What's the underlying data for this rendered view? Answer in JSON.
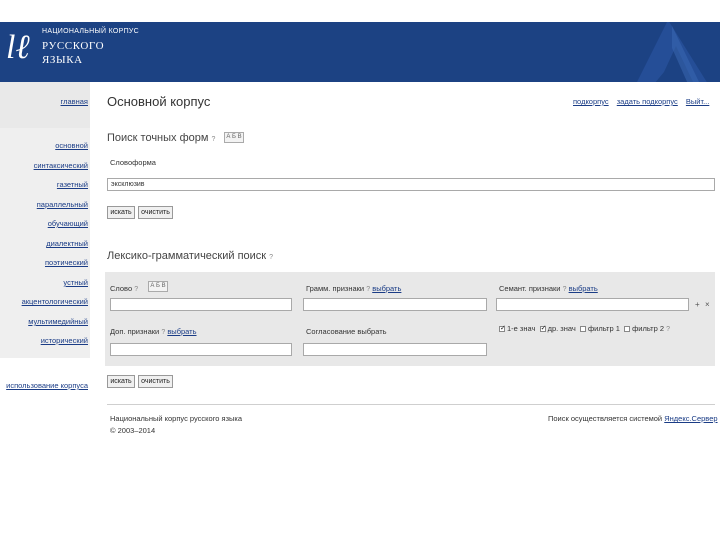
{
  "header": {
    "logo_mark": "lℓ",
    "logo_line1": "НАЦИОНАЛЬНЫЙ КОРПУС",
    "logo_line2": "РУССКОГО",
    "logo_line3": "ЯЗЫКА",
    "bg_color": "#1c4283"
  },
  "sidebar": {
    "home": "главная",
    "items": [
      "основной",
      "синтаксический",
      "газетный",
      "параллельный",
      "обучающий",
      "диалектный",
      "поэтический",
      "устный",
      "акцентологический",
      "мультимедийный",
      "исторический"
    ],
    "usage": "использование корпуса"
  },
  "main": {
    "title": "Основной корпус",
    "top_links": [
      "подкорпус",
      "задать подкорпус",
      "Выйт..."
    ]
  },
  "exact_search": {
    "title": "Поиск точных форм",
    "help": "?",
    "kb1": "А Б В",
    "field_label": "Словоформа",
    "field_value": "эксклюзив",
    "search_btn": "искать",
    "clear_btn": "очистить"
  },
  "lexgram_search": {
    "title": "Лексико-грамматический поиск",
    "help": "?",
    "word_label": "Слово",
    "kb": "А Б В",
    "gram_label": "Грамм. признаки",
    "choose": "выбрать",
    "sem_label": "Семант. признаки",
    "extra_label": "Доп. признаки",
    "choose_extra": "выбрать",
    "agreement_label": "Согласование выбрать",
    "opt1": "1-е знач",
    "opt2": "др. знач",
    "opt3": "фильтр 1",
    "opt4": "фильтр 2",
    "plus": "+",
    "minus": "×",
    "search_btn": "искать",
    "clear_btn": "очистить"
  },
  "footer": {
    "left1": "Национальный корпус русского языка",
    "left2": "© 2003–2014",
    "right_text": "Поиск осуществляется системой",
    "right_link": "Яндекс.Сервер"
  }
}
